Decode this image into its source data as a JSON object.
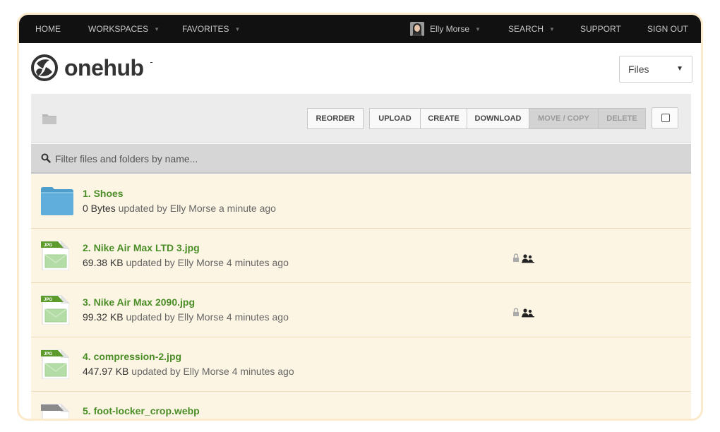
{
  "nav": {
    "home": "HOME",
    "workspaces": "WORKSPACES",
    "favorites": "FAVORITES",
    "user_name": "Elly Morse",
    "search": "SEARCH",
    "support": "SUPPORT",
    "sign_out": "SIGN OUT"
  },
  "brand": {
    "name": "onehub"
  },
  "view_select": {
    "value": "Files"
  },
  "toolbar": {
    "reorder": "REORDER",
    "upload": "UPLOAD",
    "create": "CREATE",
    "download": "DOWNLOAD",
    "move_copy": "MOVE / COPY",
    "delete": "DELETE"
  },
  "filter": {
    "placeholder": "Filter files and folders by name..."
  },
  "files": [
    {
      "num": "1.",
      "name": "Shoes",
      "size": "0 Bytes",
      "updated": "updated by Elly Morse a minute ago",
      "type": "folder"
    },
    {
      "num": "2.",
      "name": "Nike Air Max LTD 3.jpg",
      "size": "69.38 KB",
      "updated": "updated by Elly Morse 4 minutes ago",
      "type": "jpg",
      "badge": "JPG",
      "locked": true
    },
    {
      "num": "3.",
      "name": "Nike Air Max 2090.jpg",
      "size": "99.32 KB",
      "updated": "updated by Elly Morse 4 minutes ago",
      "type": "jpg",
      "badge": "JPG",
      "locked": true
    },
    {
      "num": "4.",
      "name": "compression-2.jpg",
      "size": "447.97 KB",
      "updated": "updated by Elly Morse 4 minutes ago",
      "type": "jpg",
      "badge": "JPG",
      "locked": false
    },
    {
      "num": "5.",
      "name": "foot-locker_crop.webp",
      "size": "",
      "updated": "",
      "type": "webp"
    }
  ],
  "colors": {
    "nav_bg": "#111111",
    "accent_green": "#4a8d27",
    "list_bg": "#fdf5e3",
    "folder_blue": "#5faedb"
  }
}
